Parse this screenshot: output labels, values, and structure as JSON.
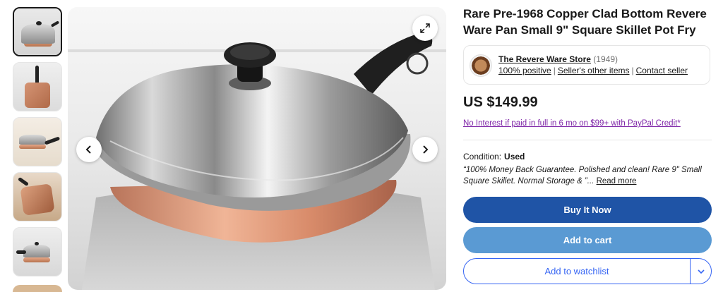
{
  "listing": {
    "title": "Rare Pre-1968 Copper Clad Bottom Revere Ware Pan Small 9\" Square Skillet Pot Fry",
    "price": "US $149.99",
    "financing": "No Interest if paid in full in 6 mo on $99+ with PayPal Credit*",
    "condition_label": "Condition:",
    "condition_value": "Used",
    "seller_notes": "“100% Money Back Guarantee. Polished and clean! Rare 9\" Small Square Skillet. Normal Storage & ”...",
    "read_more": "Read more"
  },
  "seller": {
    "name": "The Revere Ware Store",
    "feedback_count": "(1949)",
    "positive": "100% positive",
    "other_items": "Seller's other items",
    "contact": "Contact seller"
  },
  "actions": {
    "buy_now": "Buy It Now",
    "add_to_cart": "Add to cart",
    "watchlist": "Add to watchlist"
  },
  "gallery": {
    "selected_index": 0,
    "icons": {
      "expand": "expand-icon",
      "prev": "chevron-left-icon",
      "next": "chevron-right-icon",
      "dropdown": "chevron-down-icon"
    }
  },
  "colors": {
    "buy_now": "#1f54a6",
    "add_to_cart": "#5a9ad3",
    "link_blue": "#3665f3",
    "paypal_purple": "#7f26a8"
  }
}
